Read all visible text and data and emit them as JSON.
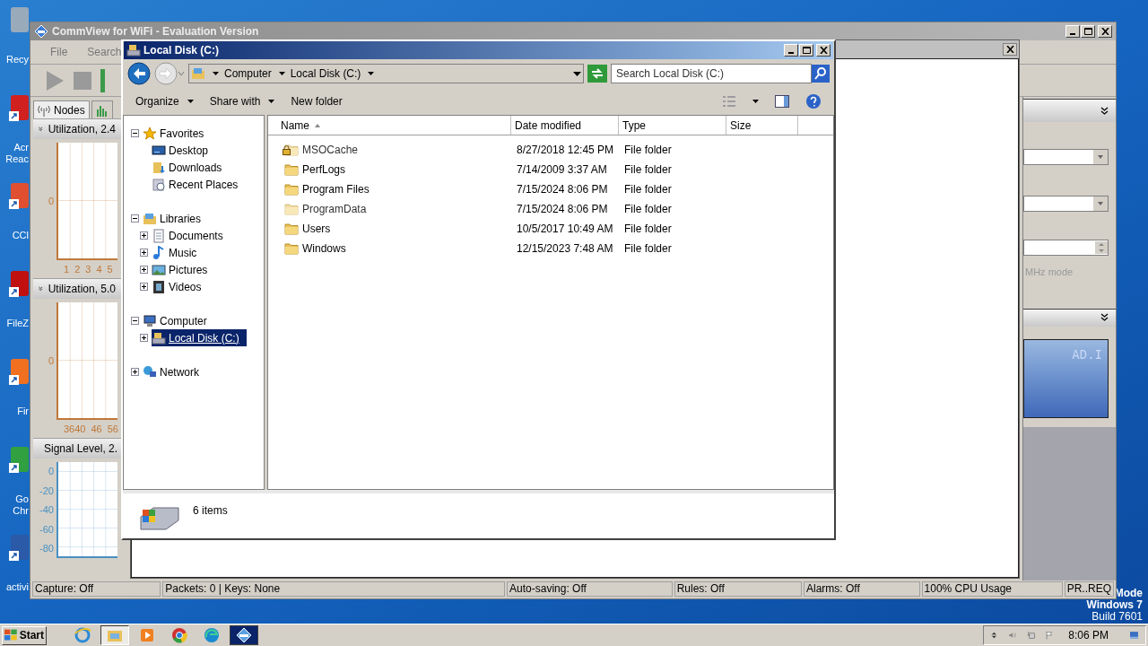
{
  "desktop": {
    "icons": [
      {
        "kind": "recycle",
        "lines": [
          "Recy"
        ]
      },
      {
        "kind": "acrobat",
        "lines": [
          "Acr",
          "Reac"
        ]
      },
      {
        "kind": "ccleaner",
        "lines": [
          "CCl"
        ]
      },
      {
        "kind": "filezilla",
        "lines": [
          "FileZ"
        ]
      },
      {
        "kind": "firefox",
        "lines": [
          "Fir"
        ]
      },
      {
        "kind": "chrome",
        "lines": [
          "Go",
          "Chr"
        ]
      },
      {
        "kind": "word",
        "lines": [
          "activi"
        ]
      }
    ],
    "notice": [
      "Mode",
      "Windows 7",
      "Build 7601"
    ]
  },
  "commview": {
    "title": "CommView for WiFi - Evaluation Version",
    "menu": [
      "File",
      "Search"
    ],
    "tabs": [
      {
        "label": "Nodes",
        "selected": true
      },
      {
        "selected": false
      }
    ],
    "panels": [
      {
        "title": "Utilization, 2.4",
        "color": "#c07838",
        "yticks": [
          "0"
        ],
        "xticks": [
          "1",
          "2",
          "3",
          "4",
          "5"
        ]
      },
      {
        "title": "Utilization, 5.0",
        "color": "#c07838",
        "yticks": [
          "0"
        ],
        "xticks": [
          "3640",
          "46",
          "56"
        ]
      },
      {
        "title": "Signal Level, 2.",
        "color": "#4a90c0",
        "yticks": [
          "0",
          "-20",
          "-40",
          "-60",
          "-80"
        ]
      }
    ],
    "mode_label": "MHz mode",
    "display_text": "AD.I",
    "status": [
      "Capture: Off",
      "Packets: 0 | Keys: None",
      "Auto-saving: Off",
      "Rules: Off",
      "Alarms: Off",
      "100% CPU Usage",
      "PR..REQ"
    ]
  },
  "explorer": {
    "title": "Local Disk (C:)",
    "breadcrumb": [
      "Computer",
      "Local Disk (C:)"
    ],
    "search": {
      "placeholder": "Search Local Disk (C:)"
    },
    "commands": [
      {
        "label": "Organize",
        "has_menu": true
      },
      {
        "label": "Share with",
        "has_menu": true
      },
      {
        "label": "New folder",
        "has_menu": false
      }
    ],
    "nav": [
      {
        "label": "Favorites",
        "kind": "star",
        "expanded": true,
        "selected": false,
        "children": [
          {
            "label": "Desktop",
            "kind": "desktop",
            "selected": false
          },
          {
            "label": "Downloads",
            "kind": "downloads",
            "selected": false
          },
          {
            "label": "Recent Places",
            "kind": "recent",
            "selected": false
          }
        ]
      },
      {
        "label": "Libraries",
        "kind": "library",
        "expanded": true,
        "selected": false,
        "children": [
          {
            "label": "Documents",
            "kind": "documents",
            "expanded": false,
            "selected": false
          },
          {
            "label": "Music",
            "kind": "music",
            "expanded": false,
            "selected": false
          },
          {
            "label": "Pictures",
            "kind": "pictures",
            "expanded": false,
            "selected": false
          },
          {
            "label": "Videos",
            "kind": "videos",
            "expanded": false,
            "selected": false
          }
        ]
      },
      {
        "label": "Computer",
        "kind": "computer",
        "expanded": true,
        "selected": false,
        "children": [
          {
            "label": "Local Disk (C:)",
            "kind": "drive",
            "expanded": false,
            "selected": true
          }
        ]
      },
      {
        "label": "Network",
        "kind": "network",
        "expanded": false,
        "selected": false
      }
    ],
    "columns": [
      {
        "label": "Name",
        "sorted": true
      },
      {
        "label": "Date modified",
        "sorted": false
      },
      {
        "label": "Type",
        "sorted": false
      },
      {
        "label": "Size",
        "sorted": false
      }
    ],
    "rows": [
      {
        "name": "MSOCache",
        "date": "8/27/2018 12:45 PM",
        "type": "File folder",
        "locked": true,
        "hidden": true
      },
      {
        "name": "PerfLogs",
        "date": "7/14/2009 3:37 AM",
        "type": "File folder",
        "locked": false,
        "hidden": false
      },
      {
        "name": "Program Files",
        "date": "7/15/2024 8:06 PM",
        "type": "File folder",
        "locked": false,
        "hidden": false
      },
      {
        "name": "ProgramData",
        "date": "7/15/2024 8:06 PM",
        "type": "File folder",
        "locked": false,
        "hidden": true
      },
      {
        "name": "Users",
        "date": "10/5/2017 10:49 AM",
        "type": "File folder",
        "locked": false,
        "hidden": false
      },
      {
        "name": "Windows",
        "date": "12/15/2023 7:48 AM",
        "type": "File folder",
        "locked": false,
        "hidden": false
      }
    ],
    "item_count": "6 items"
  },
  "taskbar": {
    "start": "Start",
    "apps": [
      {
        "kind": "ie",
        "active": false
      },
      {
        "kind": "explorer",
        "active": true
      },
      {
        "kind": "media",
        "active": false
      },
      {
        "kind": "chrome",
        "active": false
      },
      {
        "kind": "edge",
        "active": false
      },
      {
        "kind": "commview",
        "active": true
      }
    ],
    "time": "8:06 PM"
  }
}
